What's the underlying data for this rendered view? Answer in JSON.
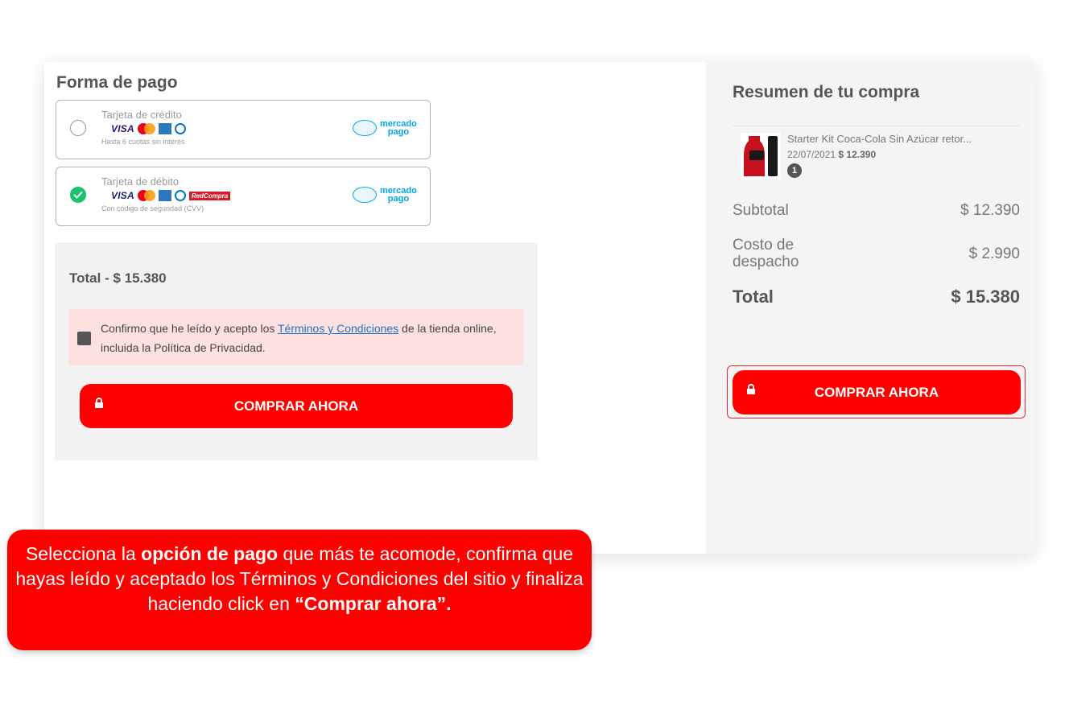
{
  "payment": {
    "title": "Forma de pago",
    "options": [
      {
        "title": "Tarjeta de crédito",
        "subtitle": "Hasta 6 cuotas sin interés",
        "card_logos": [
          "VISA",
          "mastercard",
          "amex",
          "diners"
        ],
        "provider_line1": "mercado",
        "provider_line2": "pago",
        "selected": false
      },
      {
        "title": "Tarjeta de débito",
        "subtitle": "Con código de seguridad (CVV)",
        "card_logos": [
          "VISA",
          "mastercard",
          "amex",
          "diners",
          "RedCompra"
        ],
        "provider_line1": "mercado",
        "provider_line2": "pago",
        "selected": true
      }
    ],
    "total_line": "Total - $ 15.380",
    "terms_before": "Confirmo que he leído y acepto los ",
    "terms_link": "Términos y Condiciones",
    "terms_after": " de la tienda online, incluida la Política de Privacidad.",
    "buy_label": "COMPRAR AHORA"
  },
  "summary": {
    "title": "Resumen de tu compra",
    "product": {
      "name": "Starter Kit Coca-Cola Sin Azúcar retor...",
      "date": "22/07/2021",
      "price": "$ 12.390",
      "quantity": "1"
    },
    "subtotal_label": "Subtotal",
    "subtotal_value": "$ 12.390",
    "shipping_label_1": "Costo de",
    "shipping_label_2": "despacho",
    "shipping_value": "$ 2.990",
    "total_label": "Total",
    "total_value": "$ 15.380",
    "buy_label": "COMPRAR AHORA"
  },
  "callout": {
    "part1": "Selecciona la ",
    "bold1": "opción de pago",
    "part2": " que más te acomode, confirma que hayas leído y aceptado los Términos y Condiciones del sitio y finaliza haciendo click en ",
    "bold2": "“Comprar ahora”."
  },
  "colors": {
    "accent": "#ff0000",
    "success": "#1bc26a",
    "link": "#1a73c8",
    "terms_bg": "#fde0e0",
    "mercadopago": "#00a6e9"
  }
}
